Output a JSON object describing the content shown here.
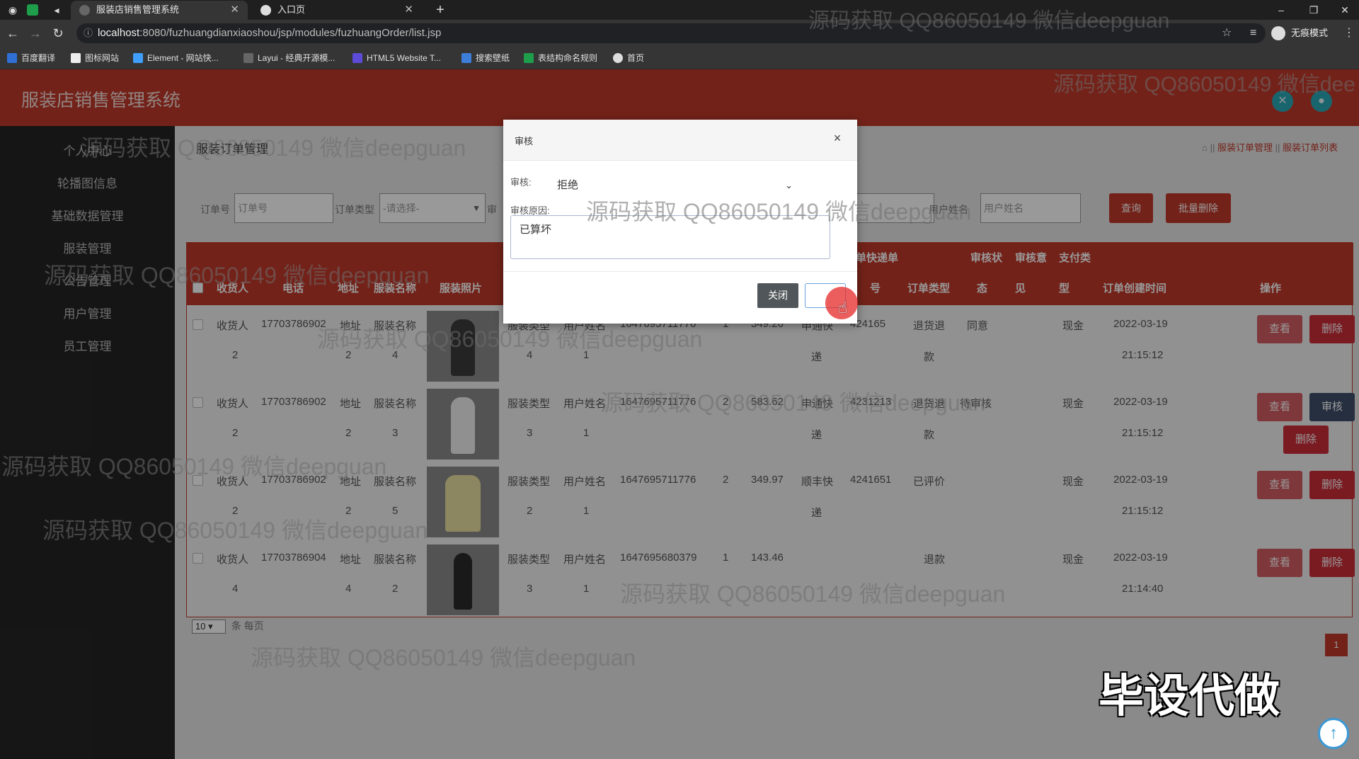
{
  "browser": {
    "tabs": [
      {
        "title": "服装店销售管理系统",
        "active": true
      },
      {
        "title": "入口页",
        "active": false
      }
    ],
    "url_host": "localhost",
    "url_path": ":8080/fuzhuangdianxiaoshou/jsp/modules/fuzhuangOrder/list.jsp",
    "incognito_label": "无痕模式",
    "bookmarks": [
      "百度翻译",
      "图标网站",
      "Element - 网站快...",
      "Layui - 经典开源模...",
      "HTML5 Website T...",
      "搜索壁纸",
      "表结构命名规则",
      "首页"
    ]
  },
  "app": {
    "title": "服装店销售管理系统",
    "sidebar": [
      "个人中心",
      "轮播图信息",
      "基础数据管理",
      "服装管理",
      "公告管理",
      "用户管理",
      "员工管理"
    ],
    "page_title": "服装订单管理",
    "breadcrumb": {
      "sep": "||",
      "level1": "服装订单管理",
      "level2": "服装订单列表"
    },
    "filters": {
      "order_no_label": "订单号",
      "order_no_placeholder": "订单号",
      "order_type_label": "订单类型",
      "order_type_value": "-请选择-",
      "partial_label": "审",
      "user_name_label": "用户姓名",
      "user_name_placeholder": "用户姓名",
      "search_button": "查询",
      "batch_delete_button": "批量删除"
    },
    "table": {
      "headers_top": [
        "单快递单",
        "审核状",
        "审核意",
        "支付类"
      ],
      "headers_bottom": [
        "收货人",
        "电话",
        "地址",
        "服装名称",
        "服装照片",
        "号",
        "订单类型",
        "态",
        "见",
        "型",
        "订单创建时间",
        "操作"
      ],
      "rows": [
        {
          "l1": [
            "收货人",
            "17703786902",
            "地址",
            "服装名称",
            "服装类型",
            "用户姓名",
            "1647695711776",
            "1",
            "349.26",
            "申通快",
            "424165",
            "退货退",
            "同意",
            "现金",
            "2022-03-19"
          ],
          "l2": [
            "2",
            "2",
            "4",
            "4",
            "1",
            "递",
            "款",
            "21:15:12"
          ],
          "actions": [
            "查看",
            "删除"
          ]
        },
        {
          "l1": [
            "收货人",
            "17703786902",
            "地址",
            "服装名称",
            "服装类型",
            "用户姓名",
            "1647695711776",
            "2",
            "583.62",
            "申通快",
            "4231213",
            "退货退",
            "待审核",
            "现金",
            "2022-03-19"
          ],
          "l2": [
            "2",
            "2",
            "3",
            "3",
            "1",
            "递",
            "款",
            "21:15:12"
          ],
          "actions": [
            "查看",
            "审核",
            "删除"
          ]
        },
        {
          "l1": [
            "收货人",
            "17703786902",
            "地址",
            "服装名称",
            "服装类型",
            "用户姓名",
            "1647695711776",
            "2",
            "349.97",
            "顺丰快",
            "4241651",
            "已评价",
            "",
            "现金",
            "2022-03-19"
          ],
          "l2": [
            "2",
            "2",
            "5",
            "2",
            "1",
            "递",
            "",
            "21:15:12"
          ],
          "actions": [
            "查看",
            "删除"
          ]
        },
        {
          "l1": [
            "收货人",
            "17703786904",
            "地址",
            "服装名称",
            "服装类型",
            "用户姓名",
            "1647695680379",
            "1",
            "143.46",
            "",
            "",
            "退款",
            "",
            "现金",
            "2022-03-19"
          ],
          "l2": [
            "4",
            "4",
            "2",
            "3",
            "1",
            "",
            "",
            "21:14:40"
          ],
          "actions": [
            "查看",
            "删除"
          ]
        }
      ]
    },
    "pager": {
      "page_size": "10",
      "suffix": "条 每页",
      "current_page": "1"
    }
  },
  "modal": {
    "title": "审核",
    "close_icon": "×",
    "audit_label": "审核:",
    "audit_value": "拒绝",
    "reason_label": "审核原因:",
    "reason_value": "已算坏",
    "close_button": "关闭"
  },
  "watermark": "源码获取 QQ86050149 微信deepguan",
  "watermark_cut": "源码获取 QQ86050149 微信dee",
  "promo": "毕设代做",
  "colors": {
    "brand_red": "#c0392b",
    "teal": "#2aa9b8",
    "sidebar": "#242424"
  }
}
